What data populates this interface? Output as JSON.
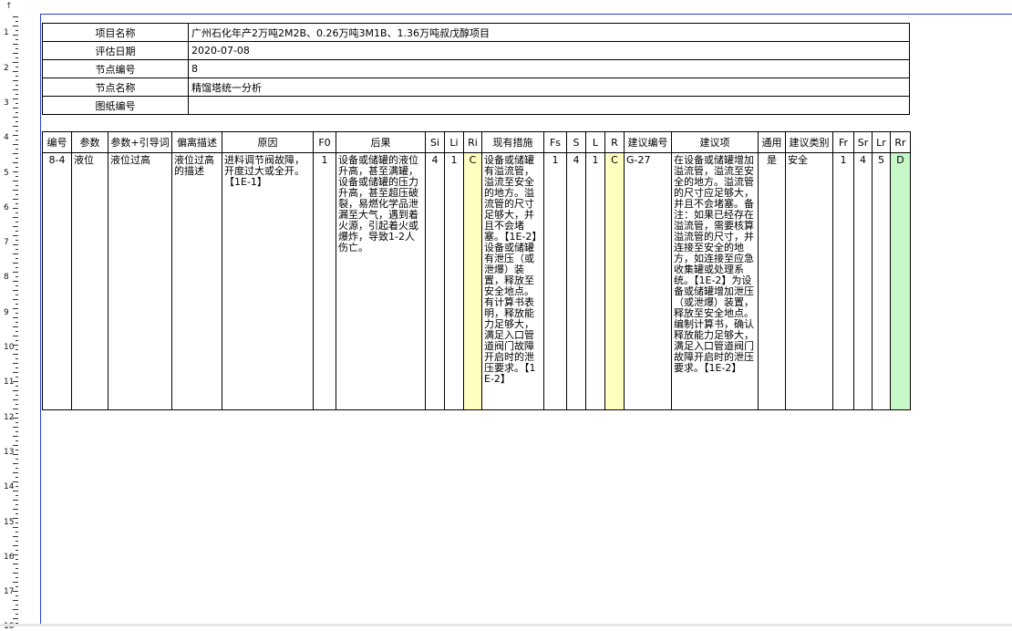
{
  "info": {
    "rows": [
      {
        "label": "项目名称",
        "value": "广州石化年产2万吨2M2B、0.26万吨3M1B、1.36万吨叔戊醇项目"
      },
      {
        "label": "评估日期",
        "value": "2020-07-08"
      },
      {
        "label": "节点编号",
        "value": "8"
      },
      {
        "label": "节点名称",
        "value": "精馏塔统一分析"
      },
      {
        "label": "图纸编号",
        "value": ""
      }
    ]
  },
  "main_table": {
    "headers": [
      "编号",
      "参数",
      "参数+引导词",
      "偏离描述",
      "原因",
      "F0",
      "后果",
      "Si",
      "Li",
      "Ri",
      "现有措施",
      "Fs",
      "S",
      "L",
      "R",
      "建议编号",
      "建议项",
      "通用",
      "建议类别",
      "Fr",
      "Sr",
      "Lr",
      "Rr"
    ],
    "row": {
      "id": "8-4",
      "param": "液位",
      "param_guide": "液位过高",
      "deviation": "液位过高的描述",
      "cause": "进料调节阀故障，开度过大或全开。【1E-1】",
      "f0": "1",
      "consequence": "设备或储罐的液位升高，甚至满罐，设备或储罐的压力升高，甚至超压破裂，易燃化学品泄漏至大气，遇到着火源，引起着火或爆炸，导致1-2人伤亡。",
      "si": "4",
      "li": "1",
      "ri": "C",
      "measures": "设备或储罐有溢流管，溢流至安全的地方。溢流管的尺寸足够大，并且不会堵塞。【1E-2】设备或储罐有泄压（或泄爆）装置，释放至安全地点。有计算书表明，释放能力足够大，满足入口管道阀门故障开启时的泄压要求。【1E-2】",
      "fs": "1",
      "s": "4",
      "l": "1",
      "r": "C",
      "rec_id": "G-27",
      "recommendation": "在设备或储罐增加溢流管，溢流至安全的地方。溢流管的尺寸应足够大，并且不会堵塞。备注：如果已经存在溢流管，需要核算溢流管的尺寸，并连接至安全的地方，如连接至应急收集罐或处理系统。【1E-2】为设备或储罐增加泄压（或泄爆）装置，释放至安全地点。编制计算书，确认释放能力足够大，满足入口管道阀门故障开启时的泄压要求。【1E-2】",
      "general": "是",
      "category": "安全",
      "fr": "1",
      "sr": "4",
      "lr": "5",
      "rr": "D"
    }
  },
  "colors": {
    "frame_blue": "#2c3ed6",
    "ri_yellow": "#ffffc0",
    "rr_green": "#c6f7c6"
  }
}
